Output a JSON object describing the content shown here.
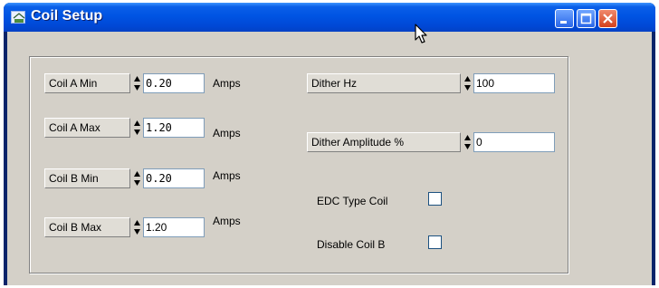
{
  "window": {
    "title": "Coil Setup",
    "icon": "app-icon",
    "controls": {
      "minimize": "minimize-icon",
      "maximize": "maximize-icon",
      "close": "close-icon"
    }
  },
  "coils": [
    {
      "label": "Coil A Min",
      "value": "0.20",
      "unit": "Amps"
    },
    {
      "label": "Coil A Max",
      "value": "1.20",
      "unit": "Amps"
    },
    {
      "label": "Coil B Min",
      "value": "0.20",
      "unit": "Amps"
    },
    {
      "label": "Coil B Max",
      "value": "1.20",
      "unit": "Amps"
    }
  ],
  "dither": {
    "hz_label": "Dither  Hz",
    "hz_value": "100",
    "amplitude_label": "Dither Amplitude %",
    "amplitude_value": "0"
  },
  "options": {
    "edc_type_coil_label": "EDC Type Coil",
    "edc_type_coil_checked": false,
    "disable_coil_b_label": "Disable Coil B",
    "disable_coil_b_checked": false
  }
}
